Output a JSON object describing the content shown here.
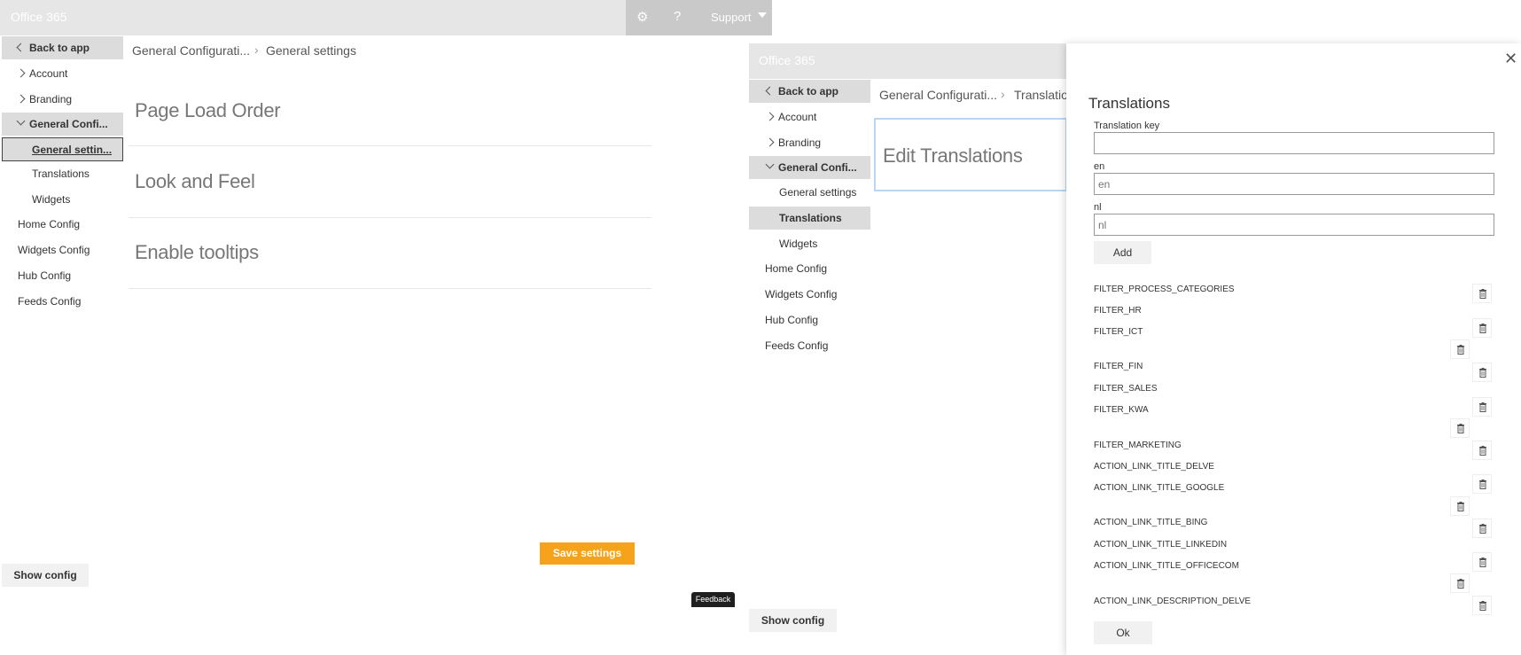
{
  "left": {
    "app_title": "Office 365",
    "support_label": "Support",
    "nav": {
      "back": "Back to app",
      "account": "Account",
      "branding": "Branding",
      "general_config": "General Confi...",
      "general_settings": "General settin...",
      "translations": "Translations",
      "widgets": "Widgets",
      "home_config": "Home Config",
      "widgets_config": "Widgets Config",
      "hub_config": "Hub Config",
      "feeds_config": "Feeds Config"
    },
    "breadcrumb": {
      "parent": "General Configurati...",
      "current": "General settings"
    },
    "sections": [
      "Page Load Order",
      "Look and Feel",
      "Enable tooltips"
    ],
    "save_button": "Save settings",
    "show_config": "Show config",
    "feedback": "Feedback"
  },
  "right": {
    "app_title": "Office 365",
    "nav": {
      "back": "Back to app",
      "account": "Account",
      "branding": "Branding",
      "general_config": "General Confi...",
      "general_settings": "General settings",
      "translations": "Translations",
      "widgets": "Widgets",
      "home_config": "Home Config",
      "widgets_config": "Widgets Config",
      "hub_config": "Hub Config",
      "feeds_config": "Feeds Config"
    },
    "breadcrumb": {
      "parent": "General Configurati...",
      "current": "Translatio"
    },
    "edit_title": "Edit Translations",
    "show_config": "Show config",
    "panel": {
      "title": "Translations",
      "key_label": "Translation key",
      "key_value": "",
      "en_label": "en",
      "en_placeholder": "en",
      "nl_label": "nl",
      "nl_placeholder": "nl",
      "add_button": "Add",
      "ok_button": "Ok",
      "keys": [
        "FILTER_PROCESS_CATEGORIES",
        "FILTER_HR",
        "FILTER_ICT",
        "FILTER_FIN",
        "FILTER_SALES",
        "FILTER_KWA",
        "FILTER_MARKETING",
        "ACTION_LINK_TITLE_DELVE",
        "ACTION_LINK_TITLE_GOOGLE",
        "ACTION_LINK_TITLE_BING",
        "ACTION_LINK_TITLE_LINKEDIN",
        "ACTION_LINK_TITLE_OFFICECOM",
        "ACTION_LINK_DESCRIPTION_DELVE"
      ]
    }
  },
  "colors": {
    "accent": "#f7a21b",
    "topbar": "#e6e6e6",
    "nav_active": "#dcdcdc"
  },
  "icons": [
    "gear-icon",
    "help-icon",
    "chevron-down-icon",
    "close-icon",
    "trash-icon"
  ]
}
